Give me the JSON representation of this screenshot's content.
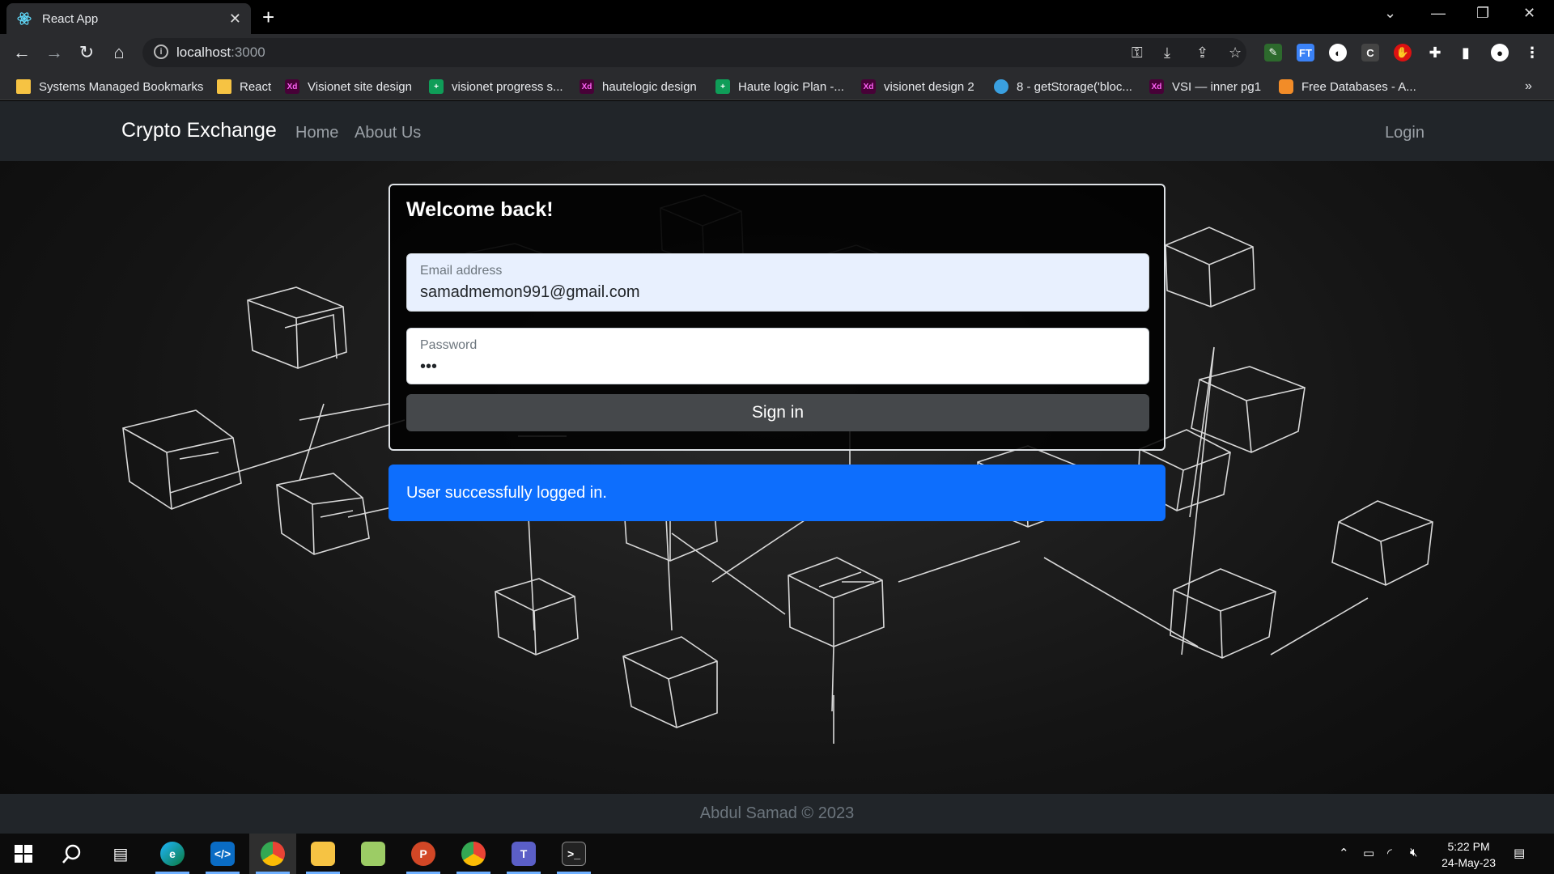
{
  "browser": {
    "tab_title": "React App",
    "url_host": "localhost",
    "url_port": ":3000",
    "bookmarks": [
      {
        "label": "Systems Managed Bookmarks",
        "icon": "folder"
      },
      {
        "label": "React",
        "icon": "folder"
      },
      {
        "label": "Visionet site design",
        "icon": "xd"
      },
      {
        "label": "visionet progress s...",
        "icon": "sheet"
      },
      {
        "label": "hautelogic design",
        "icon": "xd"
      },
      {
        "label": "Haute logic Plan -...",
        "icon": "sheet"
      },
      {
        "label": "visionet design 2",
        "icon": "xd"
      },
      {
        "label": "8 - getStorage('bloc...",
        "icon": "drop"
      },
      {
        "label": "VSI — inner pg1",
        "icon": "xd"
      },
      {
        "label": "Free Databases - A...",
        "icon": "db"
      }
    ]
  },
  "navbar": {
    "brand": "Crypto Exchange",
    "links": [
      "Home",
      "About Us"
    ],
    "login": "Login"
  },
  "login_card": {
    "title": "Welcome back!",
    "email_label": "Email address",
    "email_value": "samadmemon991@gmail.com",
    "password_label": "Password",
    "password_value": "•••",
    "submit_label": "Sign in"
  },
  "alert": {
    "message": "User successfully logged in.",
    "color": "#0d6efd"
  },
  "footer": {
    "text": "Abdul Samad © 2023"
  },
  "taskbar": {
    "time": "5:22 PM",
    "date": "24-May-23"
  }
}
